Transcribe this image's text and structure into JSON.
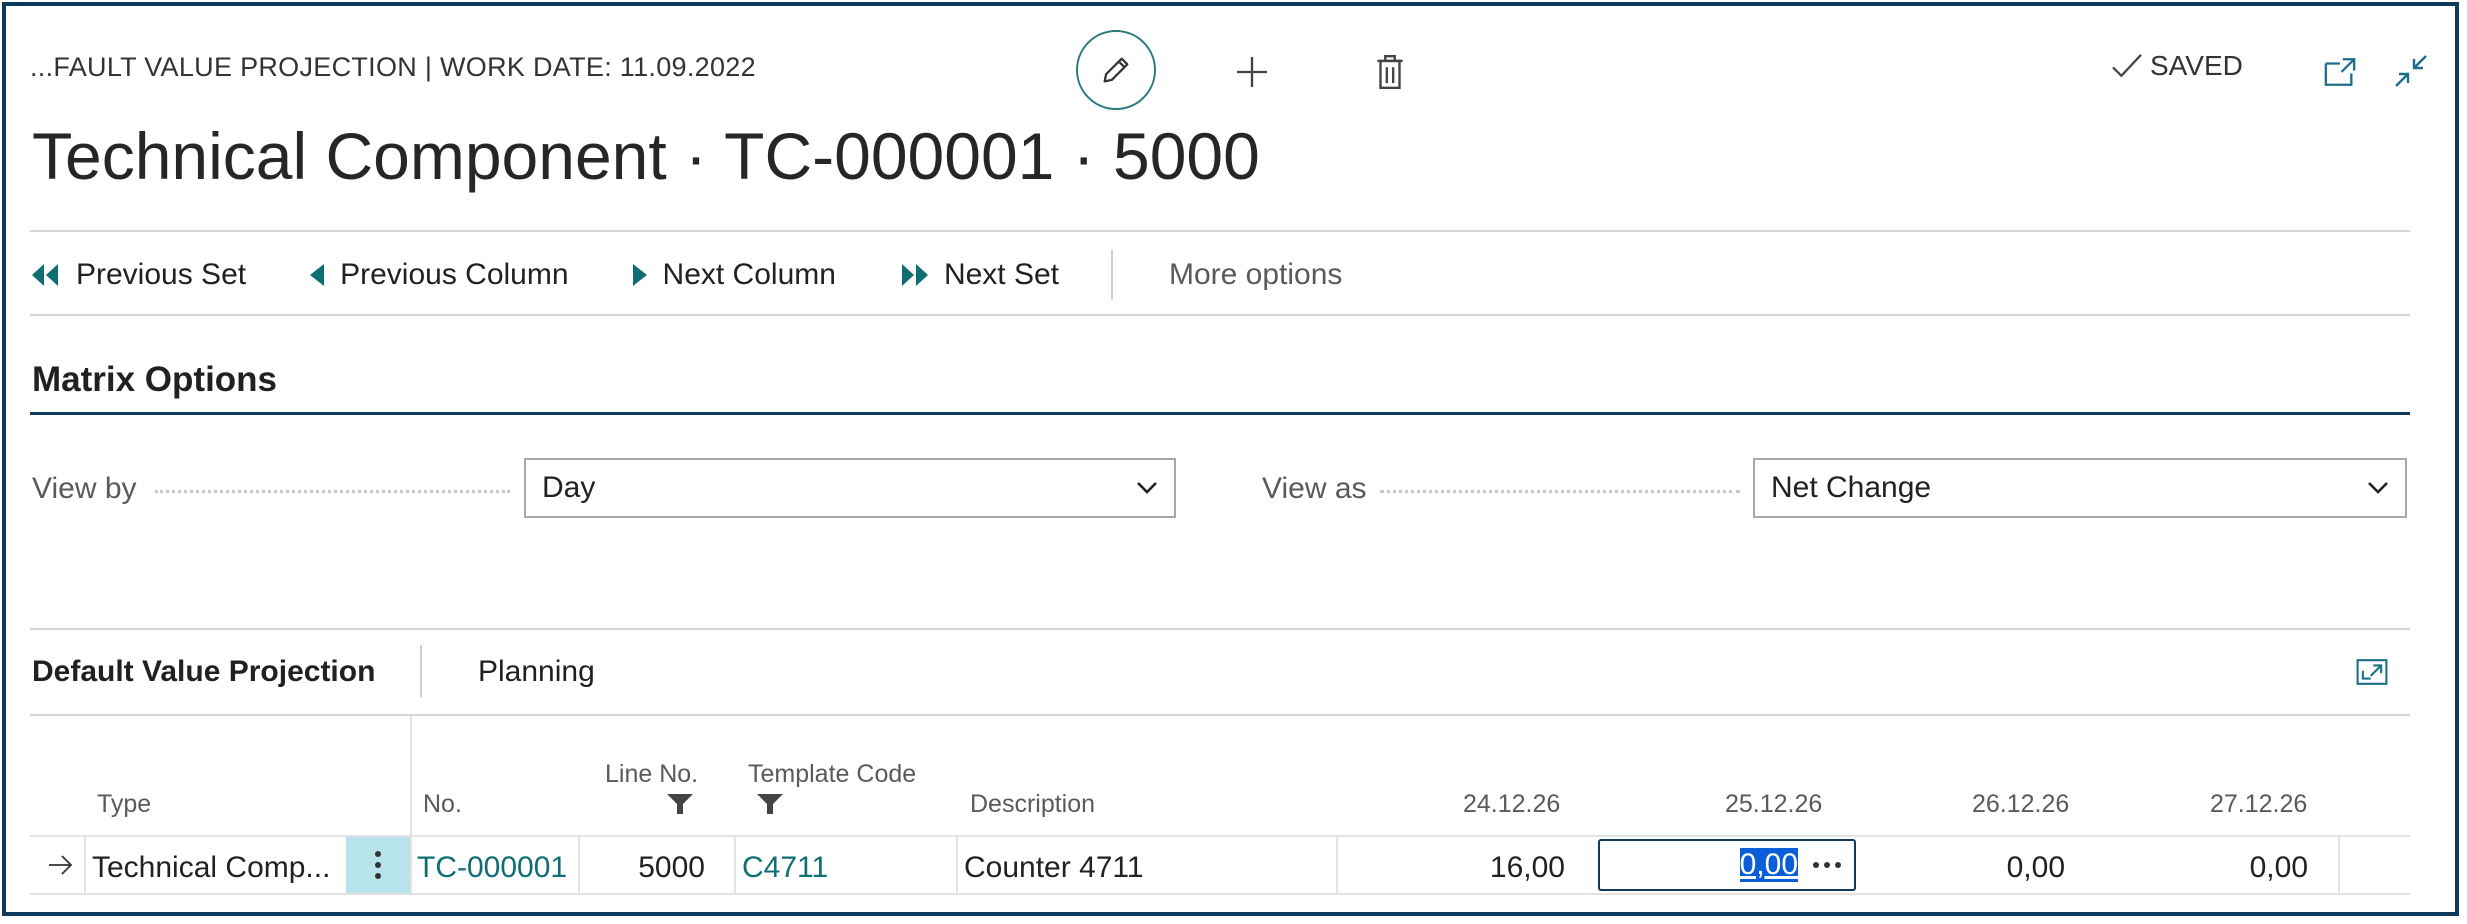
{
  "header": {
    "breadcrumb": "...FAULT VALUE PROJECTION | WORK DATE: 11.09.2022",
    "title": "Technical Component · TC-000001 · 5000",
    "saved_label": "SAVED"
  },
  "actions": {
    "previous_set": "Previous Set",
    "previous_column": "Previous Column",
    "next_column": "Next Column",
    "next_set": "Next Set",
    "more_options": "More options"
  },
  "matrix_options": {
    "title": "Matrix Options",
    "view_by_label": "View by",
    "view_by_value": "Day",
    "view_as_label": "View as",
    "view_as_value": "Net Change"
  },
  "subpage": {
    "tabs": [
      "Default Value Projection",
      "Planning"
    ]
  },
  "grid": {
    "headers": {
      "type": "Type",
      "no": "No.",
      "line_no": "Line No.",
      "template_code": "Template Code",
      "description": "Description",
      "d1": "24.12.26",
      "d2": "25.12.26",
      "d3": "26.12.26",
      "d4": "27.12.26"
    },
    "row": {
      "type": "Technical Comp...",
      "no": "TC-000001",
      "line_no": "5000",
      "template_code": "C4711",
      "description": "Counter 4711",
      "d1": "16,00",
      "d2": "0,00",
      "d3": "0,00",
      "d4": "0,00"
    }
  },
  "colors": {
    "accent": "#0e6e72",
    "frame": "#0e3a5c",
    "selection": "#0a5ed7",
    "row_menu_bg": "#b7e4ea"
  }
}
